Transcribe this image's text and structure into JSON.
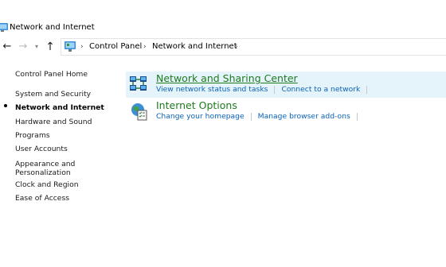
{
  "window": {
    "title": "Network and Internet"
  },
  "navigation": {
    "back_glyph": "←",
    "forward_glyph": "→",
    "recent_glyph": "▾",
    "up_glyph": "↑",
    "breadcrumb": [
      "Control Panel",
      "Network and Internet"
    ],
    "separator": "›"
  },
  "sidebar": {
    "items": [
      {
        "label": "Control Panel Home"
      },
      {
        "label": "System and Security"
      },
      {
        "label": "Network and Internet",
        "current": true
      },
      {
        "label": "Hardware and Sound"
      },
      {
        "label": "Programs"
      },
      {
        "label": "User Accounts"
      },
      {
        "label": "Appearance and\nPersonalization"
      },
      {
        "label": "Clock and Region"
      },
      {
        "label": "Ease of Access"
      }
    ]
  },
  "categories": [
    {
      "title": "Network and Sharing Center",
      "icon": "network-sharing-icon",
      "links": [
        "View network status and tasks",
        "Connect to a network"
      ]
    },
    {
      "title": "Internet Options",
      "icon": "internet-options-icon",
      "links": [
        "Change your homepage",
        "Manage browser add-ons"
      ]
    }
  ],
  "colors": {
    "title_green": "#1e7b1e",
    "link_blue": "#0a62b8",
    "selected_bg": "#e5f3fb"
  }
}
